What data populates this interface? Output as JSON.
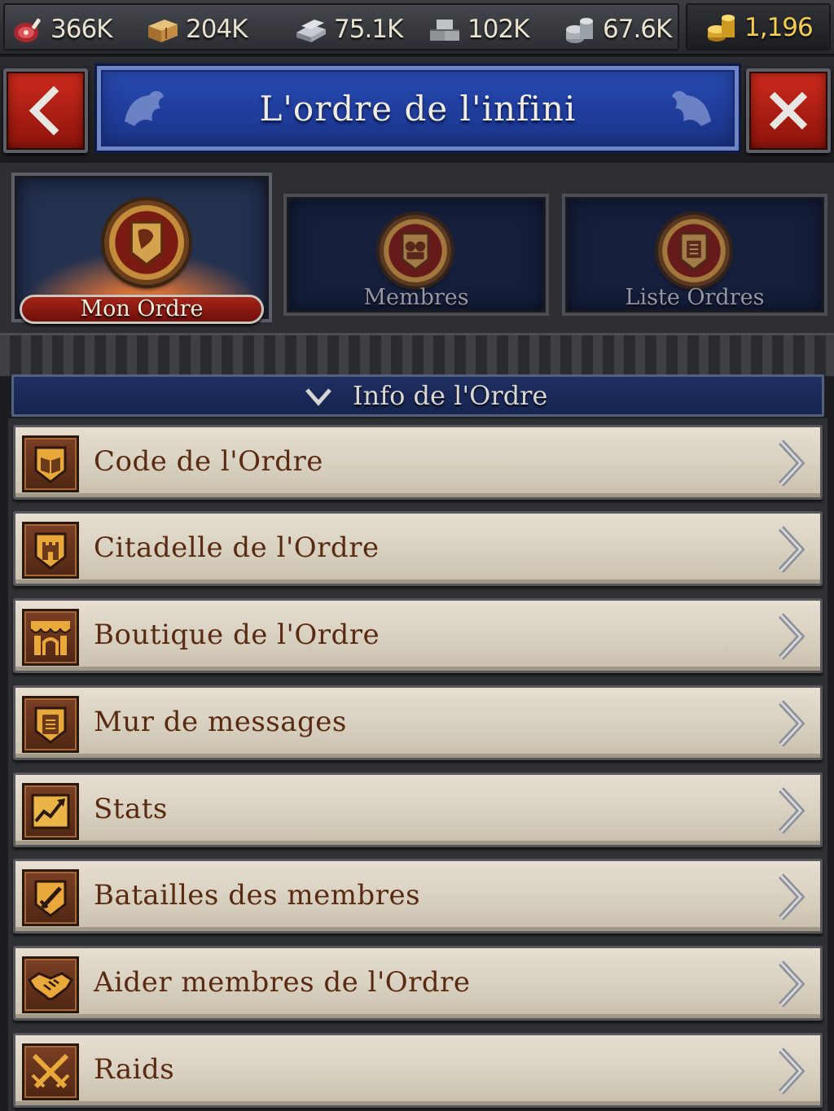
{
  "resources": [
    {
      "icon": "meat-icon",
      "value": "366K"
    },
    {
      "icon": "wood-icon",
      "value": "204K"
    },
    {
      "icon": "iron-icon",
      "value": "75.1K"
    },
    {
      "icon": "stone-icon",
      "value": "102K"
    },
    {
      "icon": "silver-icon",
      "value": "67.6K"
    }
  ],
  "gold": {
    "icon": "gold-coins-icon",
    "value": "1,196"
  },
  "header": {
    "title": "L'ordre de l'infini",
    "back_icon": "chevron-left-icon",
    "close_icon": "close-icon"
  },
  "tabs": [
    {
      "label": "Mon Ordre",
      "icon": "order-crest-icon",
      "active": true
    },
    {
      "label": "Membres",
      "icon": "members-crest-icon",
      "active": false
    },
    {
      "label": "Liste Ordres",
      "icon": "order-list-crest-icon",
      "active": false
    }
  ],
  "section": {
    "title": "Info de l'Ordre",
    "icon": "chevron-down-icon"
  },
  "menu": [
    {
      "label": "Code de l'Ordre",
      "icon": "book-shield-icon"
    },
    {
      "label": "Citadelle de l'Ordre",
      "icon": "tower-shield-icon"
    },
    {
      "label": "Boutique de l'Ordre",
      "icon": "shop-stall-icon"
    },
    {
      "label": "Mur de messages",
      "icon": "scroll-shield-icon"
    },
    {
      "label": "Stats",
      "icon": "stats-chart-icon"
    },
    {
      "label": "Batailles des membres",
      "icon": "sword-shield-icon"
    },
    {
      "label": "Aider membres de l'Ordre",
      "icon": "handshake-icon"
    },
    {
      "label": "Raids",
      "icon": "crossed-swords-icon"
    }
  ],
  "colors": {
    "accent_red": "#b8231a",
    "banner_blue": "#2141a3",
    "parchment": "#ddd5c6",
    "text_brown": "#5a2a10",
    "gold_text": "#f4cc52"
  }
}
